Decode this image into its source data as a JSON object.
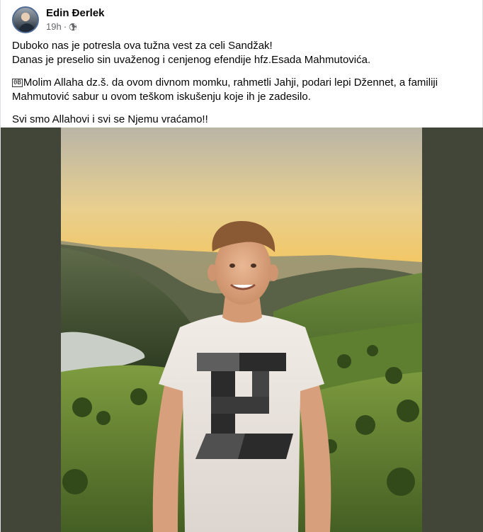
{
  "post": {
    "author": "Edin Đerlek",
    "time": "19h",
    "separator": "·",
    "audience_icon": "globe-icon",
    "paragraphs": [
      "Duboko nas je potresla ova tužna vest za celi Sandžak!",
      "Danas je preselio sin uvaženog i cenjenog efendije hfz.Esada Mahmutovića."
    ],
    "emoji_placeholder": "0B",
    "prayer": "Molim Allaha dz.š. da ovom divnom momku, rahmetli Jahji, podari lepi Džennet, a familiji Mahmutović sabur u ovom teškom iskušenju koje ih je zadesilo.",
    "closing": "Svi smo Allahovi i svi se Njemu vraćamo!!"
  },
  "colors": {
    "frame_bg": "#424638",
    "secondary_text": "#65676b",
    "primary_text": "#050505"
  }
}
